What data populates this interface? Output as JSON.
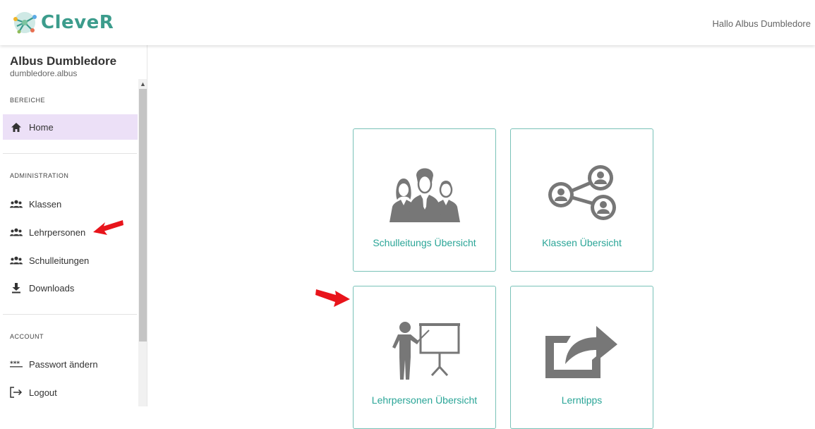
{
  "header": {
    "logo_text": "CleveR",
    "greeting": "Hallo Albus Dumbledore"
  },
  "sidebar": {
    "user_name": "Albus Dumbledore",
    "user_login": "dumbledore.albus",
    "sections": [
      {
        "label": "BEREICHE"
      },
      {
        "label": "ADMINISTRATION"
      },
      {
        "label": "ACCOUNT"
      }
    ],
    "items": [
      {
        "label": "Home",
        "icon": "home-icon",
        "active": true
      },
      {
        "label": "Klassen",
        "icon": "group-icon"
      },
      {
        "label": "Lehrpersonen",
        "icon": "group-icon"
      },
      {
        "label": "Schulleitungen",
        "icon": "group-icon"
      },
      {
        "label": "Downloads",
        "icon": "download-icon"
      },
      {
        "label": "Passwort ändern",
        "icon": "password-icon"
      },
      {
        "label": "Logout",
        "icon": "logout-icon"
      }
    ]
  },
  "cards": [
    {
      "label": "Schulleitungs Übersicht",
      "icon": "people-group-icon"
    },
    {
      "label": "Klassen Übersicht",
      "icon": "network-users-icon"
    },
    {
      "label": "Lehrpersonen Übersicht",
      "icon": "teacher-presentation-icon"
    },
    {
      "label": "Lerntipps",
      "icon": "share-arrow-icon"
    }
  ],
  "colors": {
    "accent": "#2aa597",
    "card_border": "#79c2b8",
    "active_nav": "#ece0f7",
    "arrow": "#e8141b",
    "icon_gray": "#777777"
  }
}
